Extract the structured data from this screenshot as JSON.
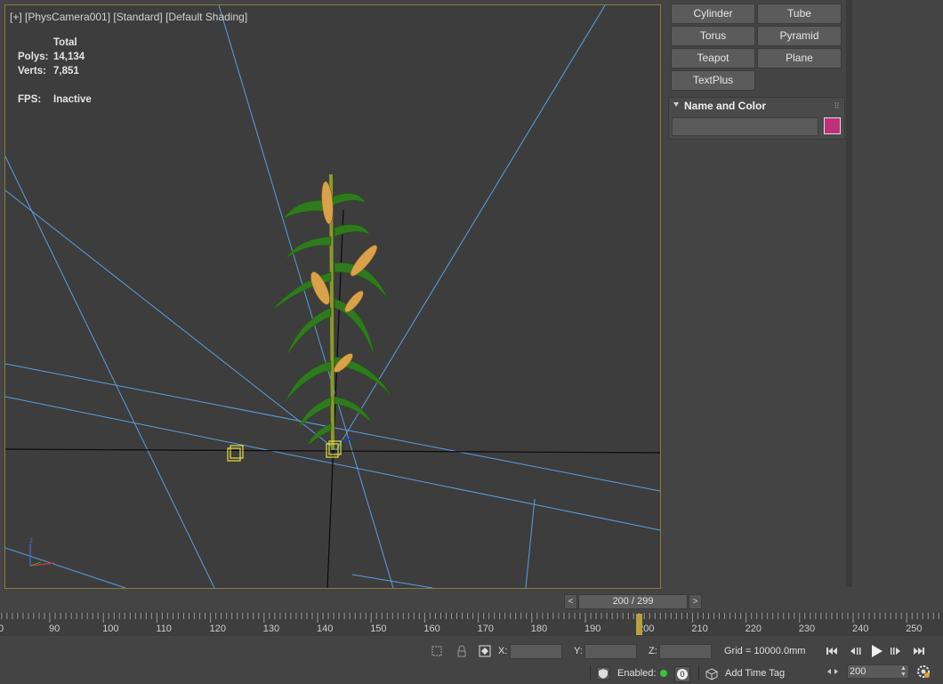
{
  "viewport": {
    "label": "[+] [PhysCamera001] [Standard] [Default Shading]",
    "stats": {
      "total_label": "Total",
      "polys_label": "Polys:",
      "polys_value": "14,134",
      "verts_label": "Verts:",
      "verts_value": "7,851",
      "fps_label": "FPS:",
      "fps_value": "Inactive"
    },
    "axis_label": "z"
  },
  "command_panel": {
    "buttons": [
      "Cylinder",
      "Tube",
      "Torus",
      "Pyramid",
      "Teapot",
      "Plane",
      "TextPlus"
    ],
    "rollout_title": "Name and Color",
    "object_name": "",
    "object_color": "#c0307a"
  },
  "time_slider": {
    "prev_label": "<",
    "next_label": ">",
    "position": "200 / 299"
  },
  "track_ruler": {
    "labels": [
      "90",
      "100",
      "110",
      "120",
      "130",
      "140",
      "150",
      "160",
      "170",
      "180",
      "190",
      "200",
      "210",
      "220",
      "230",
      "240",
      "250"
    ],
    "first_label": "0",
    "current_frame": 200
  },
  "status_bar": {
    "x_label": "X:",
    "y_label": "Y:",
    "z_label": "Z:",
    "x_value": "",
    "y_value": "",
    "z_value": "",
    "grid": "Grid = 10000.0mm",
    "enabled_label": "Enabled:",
    "enabled_count": "0",
    "add_time_tag": "Add Time Tag",
    "current_frame": "200"
  },
  "colors": {
    "viewport_border": "#8a7a3e",
    "camera_lines": "#5b9ee0",
    "selection": "#e8e040",
    "enabled_dot": "#3ac43a",
    "time_marker": "#b8a040"
  }
}
